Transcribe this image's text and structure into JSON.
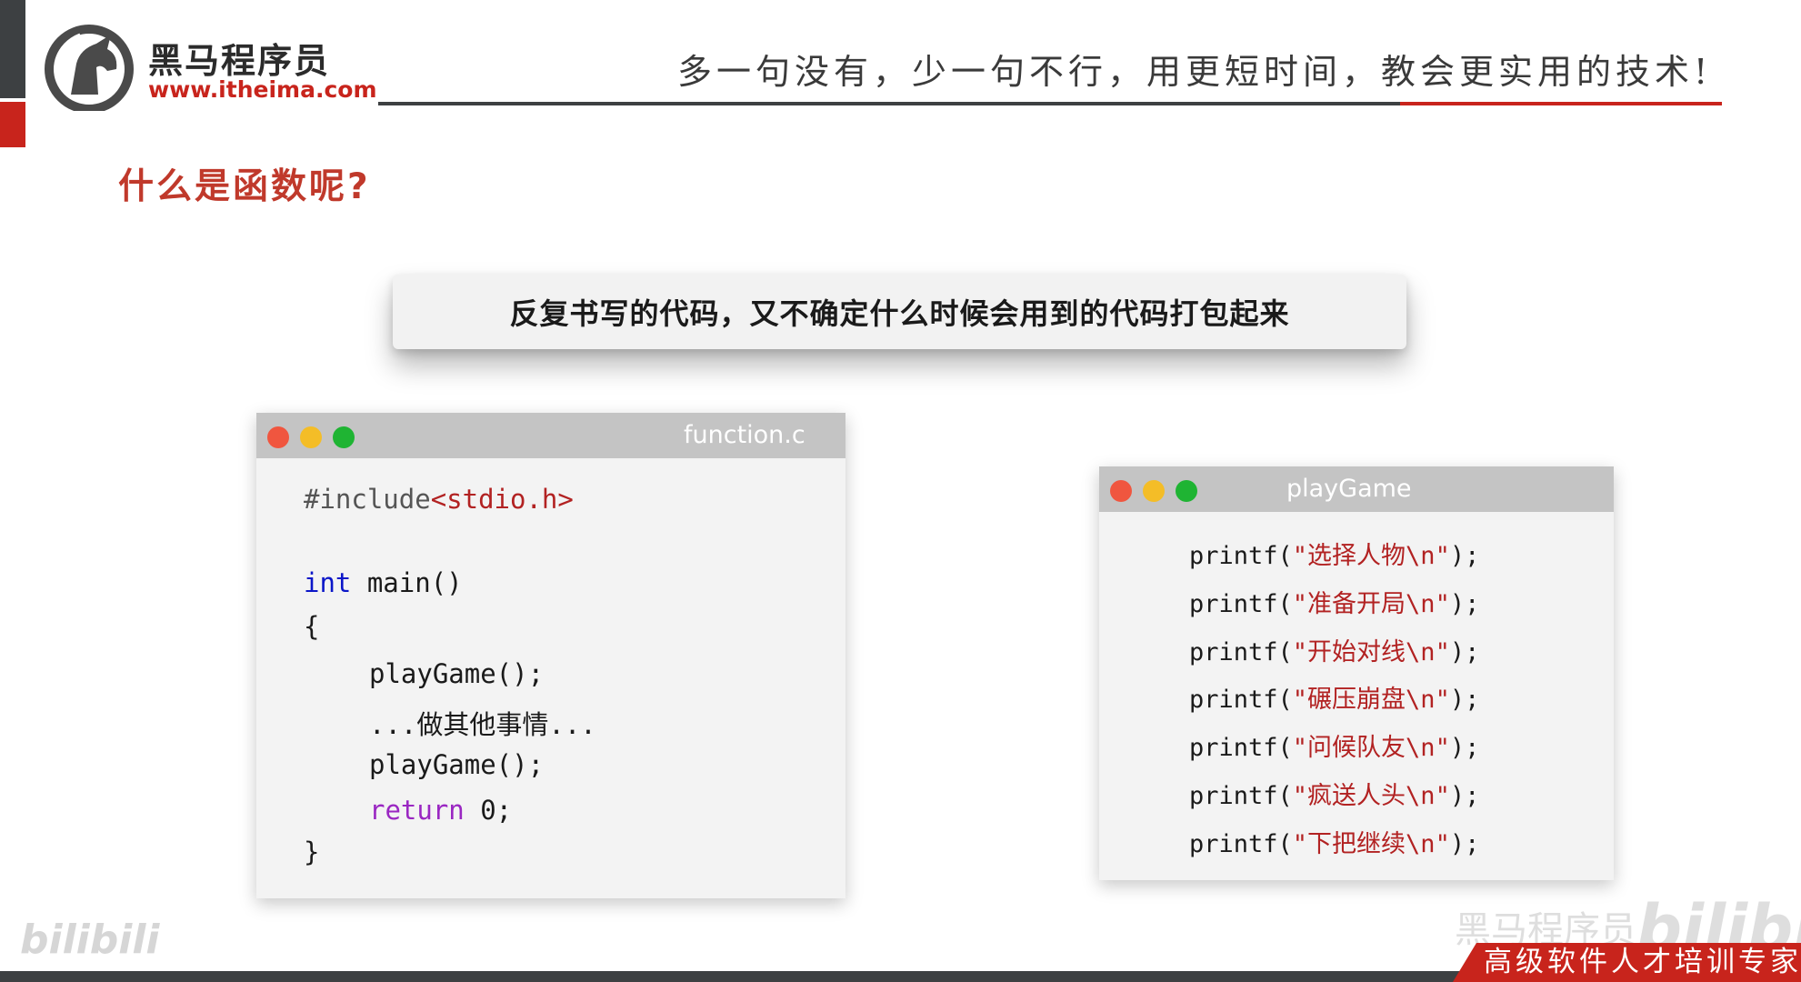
{
  "header": {
    "logo_name": "黑马程序员",
    "logo_url": "www.itheima.com",
    "slogan": "多一句没有，少一句不行，用更短时间，教会更实用的技术!"
  },
  "page_title": "什么是函数呢?",
  "banner_text": "反复书写的代码，又不确定什么时候会用到的代码打包起来",
  "left_window": {
    "title": "function.c",
    "code": {
      "include_directive": "#include",
      "include_header": "<stdio.h>",
      "int_keyword": "int",
      "main_sig": " main()",
      "open_brace": "{",
      "call_1": "playGame();",
      "other_work": "...做其他事情...",
      "call_2": "playGame();",
      "return_keyword": "return",
      "return_value": " 0;",
      "close_brace": "}"
    }
  },
  "right_window": {
    "title": "playGame",
    "lines": [
      {
        "prefix": "printf(",
        "string": "\"选择人物\\n\"",
        "suffix": ");"
      },
      {
        "prefix": "printf(",
        "string": "\"准备开局\\n\"",
        "suffix": ");"
      },
      {
        "prefix": "printf(",
        "string": "\"开始对线\\n\"",
        "suffix": ");"
      },
      {
        "prefix": "printf(",
        "string": "\"碾压崩盘\\n\"",
        "suffix": ");"
      },
      {
        "prefix": "printf(",
        "string": "\"问候队友\\n\"",
        "suffix": ");"
      },
      {
        "prefix": "printf(",
        "string": "\"疯送人头\\n\"",
        "suffix": ");"
      },
      {
        "prefix": "printf(",
        "string": "\"下把继续\\n\"",
        "suffix": ");"
      }
    ]
  },
  "watermarks": {
    "bili_left": "bilibili",
    "brand_right": "黑马程序员",
    "bili_right": "bilibili"
  },
  "footer_text": "高级软件人才培训专家",
  "colors": {
    "brand_red": "#c8241c",
    "dark_gray": "#3d4042",
    "keyword_blue": "#0b16c8",
    "keyword_purple": "#9a27c2",
    "string_red": "#b22222"
  }
}
